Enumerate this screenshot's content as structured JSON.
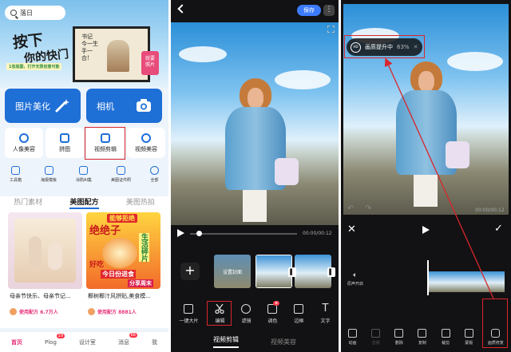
{
  "left_screen": {
    "search": {
      "placeholder": "落日"
    },
    "banner": {
      "slogan_line1": "按下",
      "slogan_line2": "你的快门",
      "promo": "1张底图，打开无限创意可能",
      "frame_note": "书记\n今一生\n手一\n合!",
      "frame_badge": "就要\n照片"
    },
    "big_buttons": [
      {
        "label": "图片美化",
        "icon": "magic-wand-icon"
      },
      {
        "label": "相机",
        "icon": "camera-icon"
      }
    ],
    "small_buttons": [
      {
        "label": "人像美容",
        "icon": "face-icon"
      },
      {
        "label": "拼图",
        "icon": "collage-icon"
      },
      {
        "label": "视频剪辑",
        "icon": "video-edit-icon"
      },
      {
        "label": "视频美容",
        "icon": "video-beauty-icon"
      }
    ],
    "tools": [
      {
        "label": "工具箱"
      },
      {
        "label": "海报模板"
      },
      {
        "label": "涂鸦AI集"
      },
      {
        "label": "美图证件照"
      },
      {
        "label": "全部"
      }
    ],
    "tabs": [
      "热门素材",
      "美图配方",
      "美图热拍"
    ],
    "active_tab": "美图配方",
    "cards": [
      {
        "title": "母亲节快乐、母亲节记...",
        "usage": "使用配方 6.7万人"
      },
      {
        "title": "椰树椰汁风拼贴,美食模...",
        "usage": "使用配方 8881人",
        "overlay1": "能够拒绝",
        "overlay2": "绝绝子",
        "overlay3": "好吃",
        "overlay4": "生活碎片",
        "overlay5": "今日份进食",
        "overlay6": "分享周末"
      }
    ],
    "nav": [
      {
        "label": "首页"
      },
      {
        "label": "Plog",
        "badge": "19"
      },
      {
        "label": "设计室"
      },
      {
        "label": "消息",
        "badge": "66"
      },
      {
        "label": "我"
      }
    ]
  },
  "middle_screen": {
    "save_label": "保存",
    "more_label": "⋮",
    "time": "00:00/00:12",
    "cover_label": "设置封面",
    "tools": [
      {
        "label": "一键大片",
        "icon": "auto-film-icon"
      },
      {
        "label": "编辑",
        "icon": "scissors-icon"
      },
      {
        "label": "滤镜",
        "icon": "filter-icon"
      },
      {
        "label": "调色",
        "icon": "adjust-icon",
        "badge": "新"
      },
      {
        "label": "边框",
        "icon": "frame-icon"
      },
      {
        "label": "文字",
        "icon": "text-icon"
      }
    ],
    "bottom_tabs": [
      "视频剪辑",
      "视频美容"
    ],
    "active_bottom_tab": "视频剪辑"
  },
  "right_screen": {
    "enhance_label": "画质提升中",
    "enhance_percent": "63%",
    "enhance_icon": "HD",
    "time": "00:00/00:12",
    "audio_label": "原声开启",
    "tools": [
      {
        "label": "动画"
      },
      {
        "label": "音频",
        "disabled": true
      },
      {
        "label": "删除"
      },
      {
        "label": "复制"
      },
      {
        "label": "裁剪"
      },
      {
        "label": "蒙版"
      },
      {
        "label": "画质修复"
      }
    ]
  },
  "colors": {
    "accent": "#1e6fd6",
    "highlight": "#d9262c",
    "save": "#3c7bff"
  }
}
